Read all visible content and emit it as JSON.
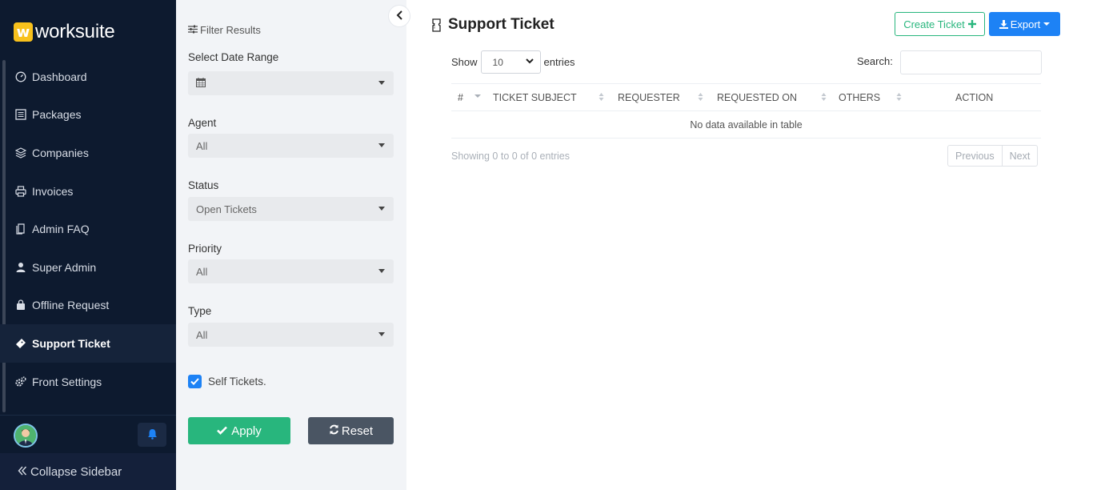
{
  "brand": {
    "mark": "w",
    "name": "worksuite"
  },
  "sidebar": {
    "items": [
      {
        "label": "Dashboard",
        "icon": "dashboard-icon"
      },
      {
        "label": "Packages",
        "icon": "packages-icon"
      },
      {
        "label": "Companies",
        "icon": "layers-icon"
      },
      {
        "label": "Invoices",
        "icon": "printer-icon"
      },
      {
        "label": "Admin FAQ",
        "icon": "faq-icon"
      },
      {
        "label": "Super Admin",
        "icon": "user-icon"
      },
      {
        "label": "Offline Request",
        "icon": "bag-icon"
      },
      {
        "label": "Support Ticket",
        "icon": "ticket-icon",
        "active": true
      },
      {
        "label": "Front Settings",
        "icon": "cogs-icon"
      }
    ],
    "collapse_label": "Collapse Sidebar"
  },
  "filters": {
    "title": "Filter Results",
    "date_range_label": "Select Date Range",
    "date_range_value": "",
    "agent_label": "Agent",
    "agent_value": "All",
    "status_label": "Status",
    "status_value": "Open Tickets",
    "priority_label": "Priority",
    "priority_value": "All",
    "type_label": "Type",
    "type_value": "All",
    "self_tickets_label": "Self Tickets.",
    "self_tickets_checked": true,
    "apply_label": "Apply",
    "reset_label": "Reset"
  },
  "main": {
    "title": "Support Ticket",
    "create_label": "Create Ticket",
    "export_label": "Export",
    "show_label": "Show",
    "entries_label": "entries",
    "page_length": "10",
    "search_label": "Search:",
    "search_value": "",
    "columns": [
      "#",
      "TICKET SUBJECT",
      "REQUESTER",
      "REQUESTED ON",
      "OTHERS",
      "ACTION"
    ],
    "empty_text": "No data available in table",
    "info_text": "Showing 0 to 0 of 0 entries",
    "prev_label": "Previous",
    "next_label": "Next"
  },
  "colors": {
    "sidebar_bg": "#0d1a2f",
    "accent_blue": "#1d82f5",
    "accent_green": "#28b67d",
    "brand_yellow": "#f8c11c"
  }
}
